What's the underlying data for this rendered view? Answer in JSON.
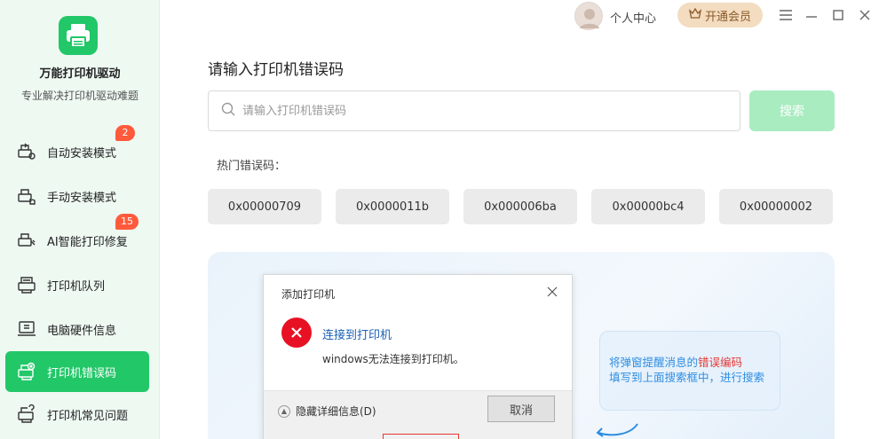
{
  "sidebar": {
    "app_name": "万能打印机驱动",
    "app_subtitle": "专业解决打印机驱动难题",
    "items": [
      {
        "label": "自动安装模式",
        "badge": "2"
      },
      {
        "label": "手动安装模式",
        "badge": ""
      },
      {
        "label": "AI智能打印修复",
        "badge": "15"
      },
      {
        "label": "打印机队列",
        "badge": ""
      },
      {
        "label": "电脑硬件信息",
        "badge": ""
      },
      {
        "label": "打印机错误码",
        "badge": ""
      },
      {
        "label": "打印机常见问题",
        "badge": ""
      }
    ],
    "active_index": 5
  },
  "topbar": {
    "user_label": "个人中心",
    "vip_label": "开通会员"
  },
  "main": {
    "title": "请输入打印机错误码",
    "search_placeholder": "请输入打印机错误码",
    "search_button": "搜索",
    "hot_label": "热门错误码：",
    "hot_codes": [
      "0x00000709",
      "0x0000011b",
      "0x000006ba",
      "0x00000bc4",
      "0x00000002"
    ]
  },
  "illustration": {
    "dialog": {
      "title": "添加打印机",
      "heading": "连接到打印机",
      "message": "windows无法连接到打印机。",
      "details_toggle": "隐藏详细信息(D)",
      "cancel": "取消"
    },
    "hint": {
      "prefix": "将弹窗提醒消息的",
      "highlight": "错误编码",
      "line2": "填写到上面搜索框中，进行搜索"
    }
  },
  "colors": {
    "accent": "#22c768",
    "sidebar_bg": "#eef9f2",
    "badge": "#ff5a3c",
    "search_button": "#a8ecc0",
    "vip": "#f3dcc0",
    "hint_text": "#2e8de0",
    "hint_highlight": "#e53935",
    "error_icon": "#e81123"
  }
}
